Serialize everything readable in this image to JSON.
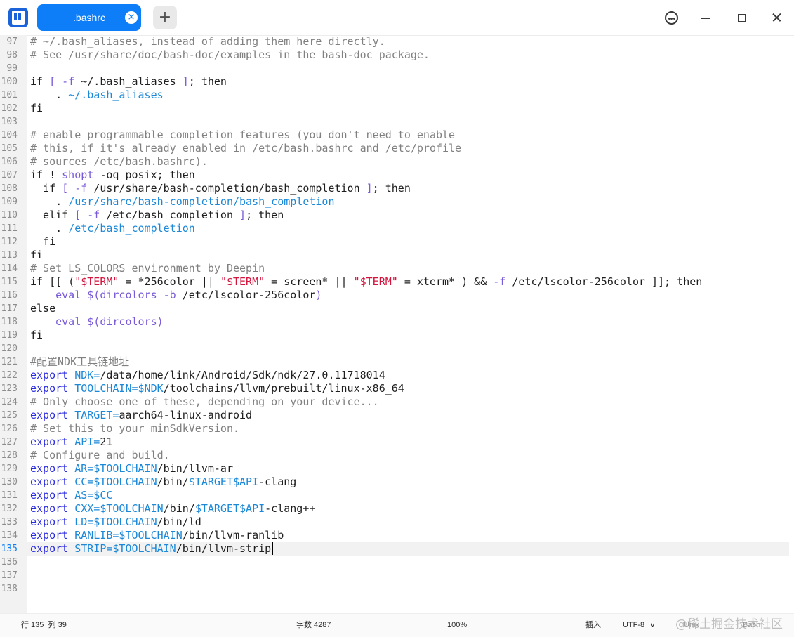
{
  "window": {
    "tab_title": ".bashrc",
    "tab_close_glyph": "×",
    "new_tab_glyph": "+",
    "icons": [
      "app-icon",
      "tab-close-icon",
      "add-tab-icon",
      "menu-icon",
      "minimize-icon",
      "maximize-icon",
      "close-icon"
    ]
  },
  "editor": {
    "current_line": 135,
    "lines": [
      {
        "n": 97,
        "tokens": [
          {
            "t": "# ~/.bash_aliases, instead of adding them here directly.",
            "c": "cmt"
          }
        ]
      },
      {
        "n": 98,
        "tokens": [
          {
            "t": "# See /usr/share/doc/bash-doc/examples in the bash-doc package.",
            "c": "cmt"
          }
        ]
      },
      {
        "n": 99,
        "tokens": []
      },
      {
        "n": 100,
        "tokens": [
          {
            "t": "if ",
            "c": ""
          },
          {
            "t": "[",
            "c": "op"
          },
          {
            "t": " ",
            "c": ""
          },
          {
            "t": "-f",
            "c": "op"
          },
          {
            "t": " ~/.bash_aliases ",
            "c": ""
          },
          {
            "t": "]",
            "c": "op"
          },
          {
            "t": "; then",
            "c": ""
          }
        ]
      },
      {
        "n": 101,
        "tokens": [
          {
            "t": "    . ",
            "c": ""
          },
          {
            "t": "~/.bash_aliases",
            "c": "path"
          }
        ]
      },
      {
        "n": 102,
        "tokens": [
          {
            "t": "fi",
            "c": ""
          }
        ]
      },
      {
        "n": 103,
        "tokens": []
      },
      {
        "n": 104,
        "tokens": [
          {
            "t": "# enable programmable completion features (you don't need to enable",
            "c": "cmt"
          }
        ]
      },
      {
        "n": 105,
        "tokens": [
          {
            "t": "# this, if it's already enabled in /etc/bash.bashrc and /etc/profile",
            "c": "cmt"
          }
        ]
      },
      {
        "n": 106,
        "tokens": [
          {
            "t": "# sources /etc/bash.bashrc).",
            "c": "cmt"
          }
        ]
      },
      {
        "n": 107,
        "tokens": [
          {
            "t": "if ! ",
            "c": ""
          },
          {
            "t": "shopt",
            "c": "op"
          },
          {
            "t": " -oq posix; then",
            "c": ""
          }
        ]
      },
      {
        "n": 108,
        "tokens": [
          {
            "t": "  if ",
            "c": ""
          },
          {
            "t": "[",
            "c": "op"
          },
          {
            "t": " ",
            "c": ""
          },
          {
            "t": "-f",
            "c": "op"
          },
          {
            "t": " /usr/share/bash-completion/bash_completion ",
            "c": ""
          },
          {
            "t": "]",
            "c": "op"
          },
          {
            "t": "; then",
            "c": ""
          }
        ]
      },
      {
        "n": 109,
        "tokens": [
          {
            "t": "    . ",
            "c": ""
          },
          {
            "t": "/usr/share/bash-completion/bash_completion",
            "c": "path"
          }
        ]
      },
      {
        "n": 110,
        "tokens": [
          {
            "t": "  elif ",
            "c": ""
          },
          {
            "t": "[",
            "c": "op"
          },
          {
            "t": " ",
            "c": ""
          },
          {
            "t": "-f",
            "c": "op"
          },
          {
            "t": " /etc/bash_completion ",
            "c": ""
          },
          {
            "t": "]",
            "c": "op"
          },
          {
            "t": "; then",
            "c": ""
          }
        ]
      },
      {
        "n": 111,
        "tokens": [
          {
            "t": "    . ",
            "c": ""
          },
          {
            "t": "/etc/bash_completion",
            "c": "path"
          }
        ]
      },
      {
        "n": 112,
        "tokens": [
          {
            "t": "  fi",
            "c": ""
          }
        ]
      },
      {
        "n": 113,
        "tokens": [
          {
            "t": "fi",
            "c": ""
          }
        ]
      },
      {
        "n": 114,
        "tokens": [
          {
            "t": "# Set LS_COLORS environment by Deepin",
            "c": "cmt"
          }
        ]
      },
      {
        "n": 115,
        "tokens": [
          {
            "t": "if [[ (",
            "c": ""
          },
          {
            "t": "\"$TERM\"",
            "c": "str"
          },
          {
            "t": " = *256color || ",
            "c": ""
          },
          {
            "t": "\"$TERM\"",
            "c": "str"
          },
          {
            "t": " = screen* || ",
            "c": ""
          },
          {
            "t": "\"$TERM\"",
            "c": "str"
          },
          {
            "t": " = xterm* ) && ",
            "c": ""
          },
          {
            "t": "-f",
            "c": "op"
          },
          {
            "t": " /etc/lscolor-256color ]]; then",
            "c": ""
          }
        ]
      },
      {
        "n": 116,
        "tokens": [
          {
            "t": "    ",
            "c": ""
          },
          {
            "t": "eval",
            "c": "op"
          },
          {
            "t": " ",
            "c": ""
          },
          {
            "t": "$(dircolors",
            "c": "op"
          },
          {
            "t": " ",
            "c": ""
          },
          {
            "t": "-b",
            "c": "op"
          },
          {
            "t": " /etc/lscolor-256color",
            "c": ""
          },
          {
            "t": ")",
            "c": "op"
          }
        ]
      },
      {
        "n": 117,
        "tokens": [
          {
            "t": "else",
            "c": ""
          }
        ]
      },
      {
        "n": 118,
        "tokens": [
          {
            "t": "    ",
            "c": ""
          },
          {
            "t": "eval",
            "c": "op"
          },
          {
            "t": " ",
            "c": ""
          },
          {
            "t": "$(dircolors)",
            "c": "op"
          }
        ]
      },
      {
        "n": 119,
        "tokens": [
          {
            "t": "fi",
            "c": ""
          }
        ]
      },
      {
        "n": 120,
        "tokens": []
      },
      {
        "n": 121,
        "tokens": [
          {
            "t": "#配置NDK工具链地址",
            "c": "cmt"
          }
        ]
      },
      {
        "n": 122,
        "tokens": [
          {
            "t": "export",
            "c": "kw"
          },
          {
            "t": " ",
            "c": ""
          },
          {
            "t": "NDK=",
            "c": "va"
          },
          {
            "t": "/data/home/link/Android/Sdk/ndk/27.0.11718014",
            "c": ""
          }
        ]
      },
      {
        "n": 123,
        "tokens": [
          {
            "t": "export",
            "c": "kw"
          },
          {
            "t": " ",
            "c": ""
          },
          {
            "t": "TOOLCHAIN=$NDK",
            "c": "va"
          },
          {
            "t": "/toolchains/llvm/prebuilt/linux-x86_64",
            "c": ""
          }
        ]
      },
      {
        "n": 124,
        "tokens": [
          {
            "t": "# Only choose one of these, depending on your device...",
            "c": "cmt"
          }
        ]
      },
      {
        "n": 125,
        "tokens": [
          {
            "t": "export",
            "c": "kw"
          },
          {
            "t": " ",
            "c": ""
          },
          {
            "t": "TARGET=",
            "c": "va"
          },
          {
            "t": "aarch64-linux-android",
            "c": ""
          }
        ]
      },
      {
        "n": 126,
        "tokens": [
          {
            "t": "# Set this to your minSdkVersion.",
            "c": "cmt"
          }
        ]
      },
      {
        "n": 127,
        "tokens": [
          {
            "t": "export",
            "c": "kw"
          },
          {
            "t": " ",
            "c": ""
          },
          {
            "t": "API=",
            "c": "va"
          },
          {
            "t": "21",
            "c": ""
          }
        ]
      },
      {
        "n": 128,
        "tokens": [
          {
            "t": "# Configure and build.",
            "c": "cmt"
          }
        ]
      },
      {
        "n": 129,
        "tokens": [
          {
            "t": "export",
            "c": "kw"
          },
          {
            "t": " ",
            "c": ""
          },
          {
            "t": "AR=$TOOLCHAIN",
            "c": "va"
          },
          {
            "t": "/bin/llvm-ar",
            "c": ""
          }
        ]
      },
      {
        "n": 130,
        "tokens": [
          {
            "t": "export",
            "c": "kw"
          },
          {
            "t": " ",
            "c": ""
          },
          {
            "t": "CC=$TOOLCHAIN",
            "c": "va"
          },
          {
            "t": "/bin/",
            "c": ""
          },
          {
            "t": "$TARGET$API",
            "c": "va"
          },
          {
            "t": "-clang",
            "c": ""
          }
        ]
      },
      {
        "n": 131,
        "tokens": [
          {
            "t": "export",
            "c": "kw"
          },
          {
            "t": " ",
            "c": ""
          },
          {
            "t": "AS=$CC",
            "c": "va"
          }
        ]
      },
      {
        "n": 132,
        "tokens": [
          {
            "t": "export",
            "c": "kw"
          },
          {
            "t": " ",
            "c": ""
          },
          {
            "t": "CXX=$TOOLCHAIN",
            "c": "va"
          },
          {
            "t": "/bin/",
            "c": ""
          },
          {
            "t": "$TARGET$API",
            "c": "va"
          },
          {
            "t": "-clang++",
            "c": ""
          }
        ]
      },
      {
        "n": 133,
        "tokens": [
          {
            "t": "export",
            "c": "kw"
          },
          {
            "t": " ",
            "c": ""
          },
          {
            "t": "LD=$TOOLCHAIN",
            "c": "va"
          },
          {
            "t": "/bin/ld",
            "c": ""
          }
        ]
      },
      {
        "n": 134,
        "tokens": [
          {
            "t": "export",
            "c": "kw"
          },
          {
            "t": " ",
            "c": ""
          },
          {
            "t": "RANLIB=$TOOLCHAIN",
            "c": "va"
          },
          {
            "t": "/bin/llvm-ranlib",
            "c": ""
          }
        ]
      },
      {
        "n": 135,
        "tokens": [
          {
            "t": "export",
            "c": "kw"
          },
          {
            "t": " ",
            "c": ""
          },
          {
            "t": "STRIP=$TOOLCHAIN",
            "c": "va"
          },
          {
            "t": "/bin/llvm-strip",
            "c": ""
          }
        ]
      },
      {
        "n": 136,
        "tokens": []
      },
      {
        "n": 137,
        "tokens": []
      },
      {
        "n": 138,
        "tokens": []
      }
    ]
  },
  "status": {
    "cursor": "行 135  列 39",
    "chars": "字数 4287",
    "zoom": "100%",
    "mode": "插入",
    "encoding": "UTF-8",
    "dropdown_glyph": "∨",
    "eol": "Unix",
    "syntax": "Bash",
    "watermark": "@稀土掘金技术社区"
  },
  "colors": {
    "accent": "#0d7ef7",
    "comment": "#808080",
    "keyword": "#2c2ce0",
    "variable": "#1b88d8",
    "operator": "#7a5ad8",
    "string": "#d3143c"
  }
}
